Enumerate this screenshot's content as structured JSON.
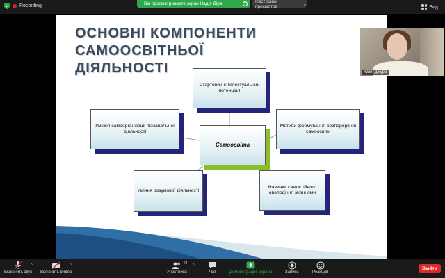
{
  "topbar": {
    "recording_label": "Recording",
    "share_banner": "Вы просматриваете экран Надія Діра",
    "view_settings": "Настройки просмотра",
    "view_label": "Вид"
  },
  "slide": {
    "title_line1": "ОСНОВНІ КОМПОНЕНТИ САМООСВІТНЬОЇ",
    "title_line2": "ДІЯЛЬНОСТІ",
    "nodes": {
      "center": "Самоосвіта",
      "top": "Стартовий інтелектуальний потенціал",
      "left": "Уміння самоорганізації пізнавальної діяльності",
      "right": "Мотиви формування безперервної самоосвіти",
      "bottom_left": "Уміння розумової діяльності",
      "bottom_right": "Навички самостійного оволодіння знаннями"
    }
  },
  "video": {
    "participant_name": "Юлія Джура"
  },
  "toolbar": {
    "unmute": "Включить звук",
    "start_video": "Включить видео",
    "participants": "Участники",
    "participants_count": "24",
    "chat": "Чат",
    "share_screen": "Демонстрация экрана",
    "record": "Запись",
    "reactions": "Реакции",
    "end": "Выйти"
  },
  "colors": {
    "share_green": "#2ea84a",
    "node_shadow_blue": "#25237a",
    "center_shadow_green": "#8cbf2a",
    "end_red": "#e02a2a"
  }
}
